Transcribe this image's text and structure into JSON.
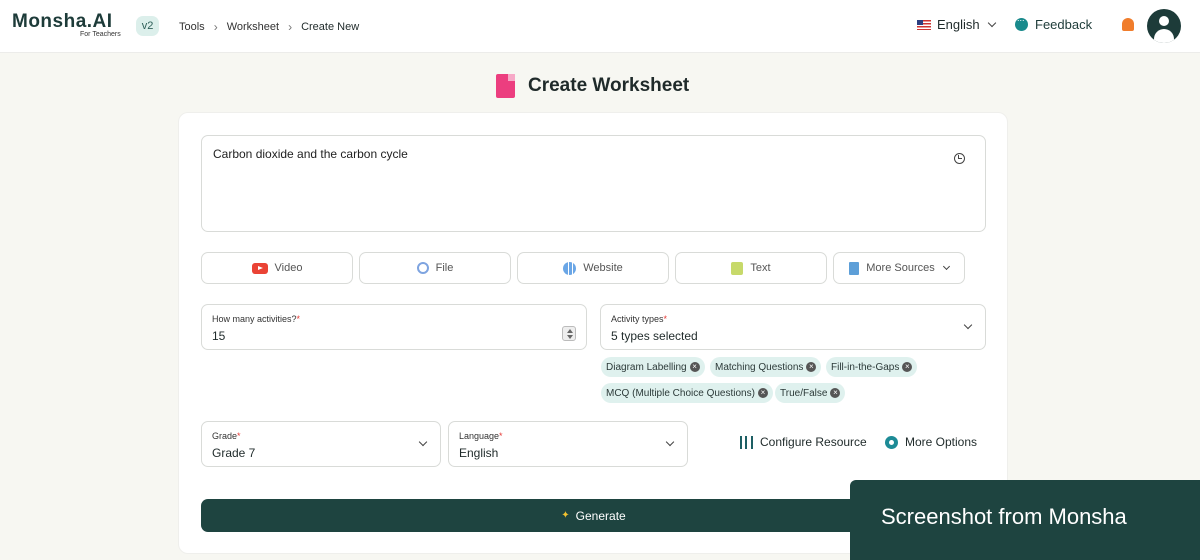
{
  "header": {
    "logo": "Monsha.AI",
    "logo_sub": "For Teachers",
    "version": "v2",
    "breadcrumbs": [
      "Tools",
      "Worksheet",
      "Create New"
    ],
    "language": "English",
    "feedback": "Feedback"
  },
  "page": {
    "title": "Create Worksheet"
  },
  "form": {
    "topic": "Carbon dioxide and the carbon cycle",
    "sources": [
      {
        "label": "Video",
        "icon": "video-icon"
      },
      {
        "label": "File",
        "icon": "paperclip-icon"
      },
      {
        "label": "Website",
        "icon": "globe-icon"
      },
      {
        "label": "Text",
        "icon": "text-icon"
      },
      {
        "label": "More Sources",
        "icon": "book-icon"
      }
    ],
    "activities": {
      "label": "How many activities?",
      "required": "*",
      "value": "15"
    },
    "activity_types": {
      "label": "Activity types",
      "required": "*",
      "value": "5 types selected",
      "selected": [
        "Diagram Labelling",
        "Matching Questions",
        "Fill-in-the-Gaps",
        "MCQ (Multiple Choice Questions)",
        "True/False"
      ]
    },
    "grade": {
      "label": "Grade",
      "required": "*",
      "value": "Grade 7"
    },
    "language": {
      "label": "Language",
      "required": "*",
      "value": "English"
    },
    "configure": "Configure Resource",
    "more_options": "More Options",
    "generate": "Generate"
  },
  "watermark": "Screenshot from Monsha",
  "colors": {
    "primary": "#1e4440",
    "accent_pink": "#ec3e7f",
    "chip_bg": "#dff1ee"
  }
}
